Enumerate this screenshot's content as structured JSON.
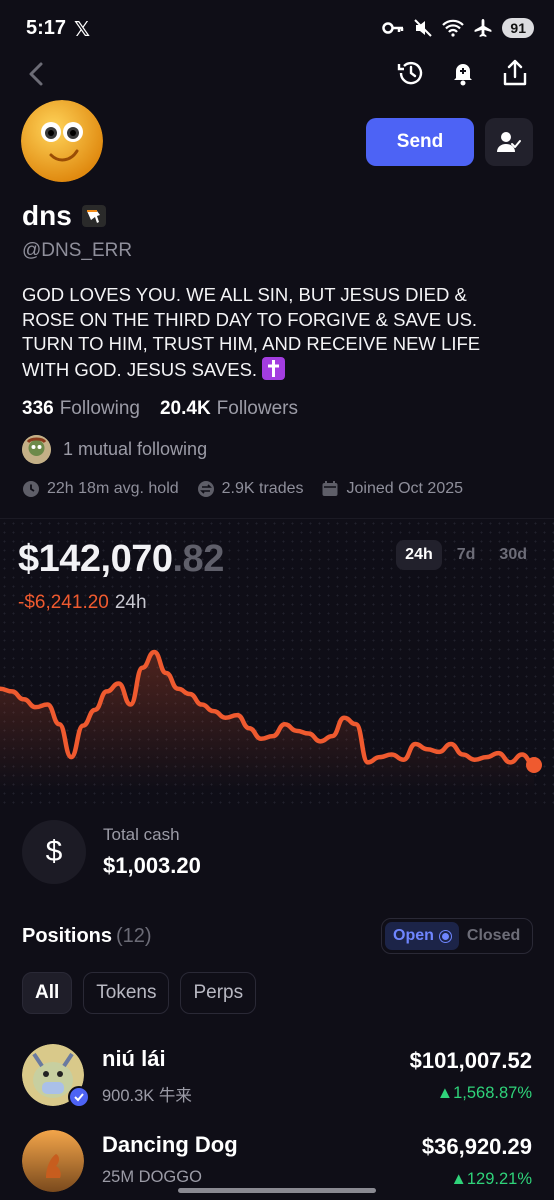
{
  "status_bar": {
    "time": "5:17",
    "app_glyph": "𝕏",
    "battery": "91"
  },
  "profile": {
    "send_label": "Send",
    "name": "dns",
    "handle": "@DNS_ERR",
    "bio": "GOD LOVES YOU. WE ALL SIN, BUT JESUS DIED & ROSE ON THE THIRD DAY TO FORGIVE & SAVE US. TURN TO HIM, TRUST HIM, AND RECEIVE NEW LIFE WITH GOD. JESUS SAVES.",
    "following_count": "336",
    "following_label": "Following",
    "followers_count": "20.4K",
    "followers_label": "Followers",
    "mutual": "1 mutual following",
    "avg_hold": "22h 18m avg. hold",
    "trades": "2.9K trades",
    "joined": "Joined Oct 2025"
  },
  "portfolio": {
    "balance_main": "$142,070",
    "balance_cents": ".82",
    "change": "-$6,241.20",
    "change_period": "24h",
    "ranges": [
      "24h",
      "7d",
      "30d"
    ],
    "active_range": "24h",
    "line_color": "#ef5a2f",
    "cash_label": "Total cash",
    "cash_value": "$1,003.20"
  },
  "chart_data": {
    "type": "line",
    "title": "",
    "xlabel": "",
    "ylabel": "",
    "values": [
      72,
      70,
      64,
      58,
      60,
      45,
      20,
      44,
      56,
      70,
      76,
      60,
      88,
      100,
      84,
      72,
      68,
      60,
      55,
      50,
      52,
      42,
      34,
      36,
      45,
      40,
      38,
      32,
      36,
      50,
      45,
      16,
      20,
      22,
      18,
      30,
      26,
      24,
      30,
      22,
      18,
      20,
      23,
      16,
      22,
      14
    ]
  },
  "positions": {
    "title": "Positions",
    "count": "(12)",
    "toggle_open": "Open",
    "toggle_closed": "Closed",
    "filters": [
      "All",
      "Tokens",
      "Perps"
    ],
    "items": [
      {
        "name": "niú lái",
        "sub": "900.3K 牛来",
        "value": "$101,007.52",
        "pct": "▲1,568.87%"
      },
      {
        "name": "Dancing Dog",
        "sub": "25M DOGGO",
        "value": "$36,920.29",
        "pct": "▲129.21%"
      }
    ]
  }
}
